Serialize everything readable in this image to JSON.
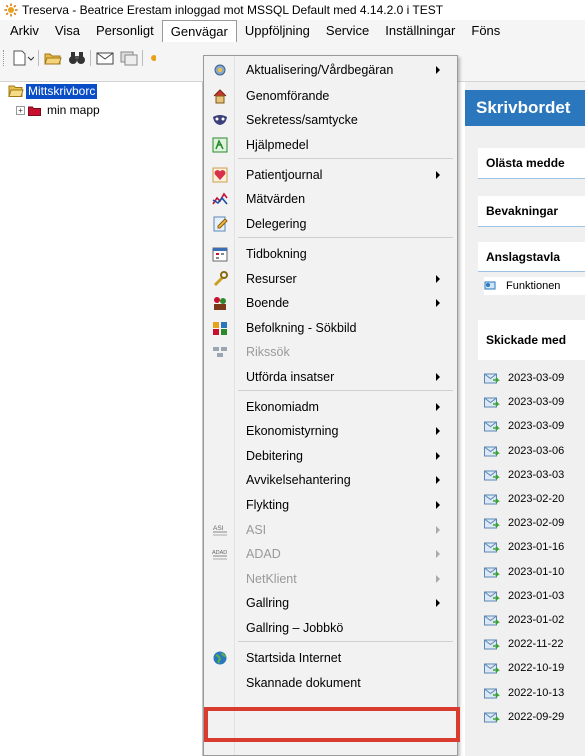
{
  "window": {
    "title": "Treserva - Beatrice Erestam inloggad mot MSSQL Default  med 4.14.2.0 i TEST"
  },
  "menubar": {
    "items": [
      "Arkiv",
      "Visa",
      "Personligt",
      "Genvägar",
      "Uppföljning",
      "Service",
      "Inställningar",
      "Föns"
    ],
    "open_index": 3
  },
  "tree": {
    "selected_label": "Mittskrivborc",
    "folder_label": "min mapp",
    "expand_glyph": "+"
  },
  "desk": {
    "title": "Skrivbordet",
    "sections": {
      "unread": "Olästa medde",
      "watch": "Bevakningar",
      "board": "Anslagstavla",
      "sent": "Skickade med"
    },
    "board_item": "Funktionen",
    "sent_dates": [
      "2023-03-09",
      "2023-03-09",
      "2023-03-09",
      "2023-03-06",
      "2023-03-03",
      "2023-02-20",
      "2023-02-09",
      "2023-01-16",
      "2023-01-10",
      "2023-01-03",
      "2023-01-02",
      "2022-11-22",
      "2022-10-19",
      "2022-10-13",
      "2022-09-29"
    ]
  },
  "dropdown": {
    "items": [
      {
        "label": "Aktualisering/Vårdbegäran",
        "icon": "gear-icon",
        "submenu": true,
        "disabled": false
      },
      {
        "label": "Genomförande",
        "icon": "house-icon",
        "submenu": false,
        "disabled": false
      },
      {
        "label": "Sekretess/samtycke",
        "icon": "mask-icon",
        "submenu": false,
        "disabled": false
      },
      {
        "label": "Hjälpmedel",
        "icon": "walker-icon",
        "submenu": false,
        "disabled": false
      },
      {
        "label": "Patientjournal",
        "icon": "heart-icon",
        "submenu": true,
        "disabled": false
      },
      {
        "label": "Mätvärden",
        "icon": "chart-icon",
        "submenu": false,
        "disabled": false
      },
      {
        "label": "Delegering",
        "icon": "delegation-icon",
        "submenu": false,
        "disabled": false
      },
      {
        "label": "Tidbokning",
        "icon": "calendar-icon",
        "submenu": false,
        "disabled": false
      },
      {
        "label": "Resurser",
        "icon": "wrench-icon",
        "submenu": true,
        "disabled": false
      },
      {
        "label": "Boende",
        "icon": "people-icon",
        "submenu": true,
        "disabled": false
      },
      {
        "label": "Befolkning - Sökbild",
        "icon": "population-icon",
        "submenu": false,
        "disabled": false
      },
      {
        "label": "Rikssök",
        "icon": "grid-icon",
        "submenu": false,
        "disabled": true
      },
      {
        "label": "Utförda insatser",
        "icon": "",
        "submenu": true,
        "disabled": false
      },
      {
        "label": "Ekonomiadm",
        "icon": "",
        "submenu": true,
        "disabled": false
      },
      {
        "label": "Ekonomistyrning",
        "icon": "",
        "submenu": true,
        "disabled": false
      },
      {
        "label": "Debitering",
        "icon": "",
        "submenu": true,
        "disabled": false
      },
      {
        "label": "Avvikelsehantering",
        "icon": "",
        "submenu": true,
        "disabled": false
      },
      {
        "label": "Flykting",
        "icon": "",
        "submenu": true,
        "disabled": false
      },
      {
        "label": "ASI",
        "icon": "asi-icon",
        "submenu": true,
        "disabled": true
      },
      {
        "label": "ADAD",
        "icon": "adad-icon",
        "submenu": true,
        "disabled": true
      },
      {
        "label": "NetKlient",
        "icon": "",
        "submenu": true,
        "disabled": true
      },
      {
        "label": "Gallring",
        "icon": "",
        "submenu": true,
        "disabled": false
      },
      {
        "label": "Gallring – Jobbkö",
        "icon": "",
        "submenu": false,
        "disabled": false
      },
      {
        "label": "Startsida Internet",
        "icon": "globe-icon",
        "submenu": false,
        "disabled": false
      },
      {
        "label": "Skannade dokument",
        "icon": "",
        "submenu": false,
        "disabled": false
      }
    ],
    "icon_text": {
      "asi": "ASI",
      "adad": "ADAD"
    },
    "highlighted_item": "Skannade dokument",
    "highlight_color": "#d93b2e"
  }
}
